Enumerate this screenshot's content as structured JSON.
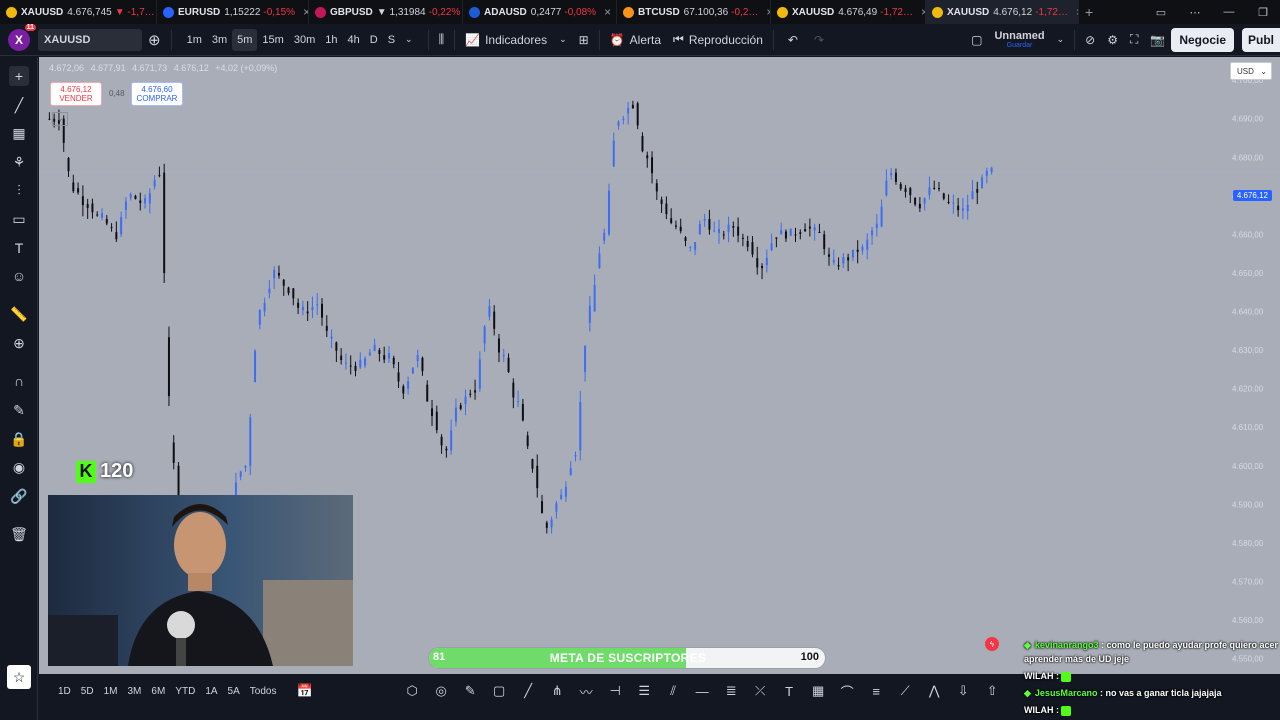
{
  "tabs": [
    {
      "symbol": "XAUUSD",
      "price": "4.676,745",
      "change": "▼ -1,7…",
      "coin_color": "#f0b90b"
    },
    {
      "symbol": "EURUSD",
      "price": "1,15222",
      "change": "-0,15%",
      "coin_color": "#2962ff"
    },
    {
      "symbol": "GBPUSD",
      "price": "▼ 1,31984",
      "change": "-0,22%",
      "coin_color": "#c2185b"
    },
    {
      "symbol": "ADAUSD",
      "price": "0,2477",
      "change": "-0,08%",
      "coin_color": "#1e5bd7"
    },
    {
      "symbol": "BTCUSD",
      "price": "67.100,36",
      "change": "-0,2…",
      "coin_color": "#f7931a"
    },
    {
      "symbol": "XAUUSD",
      "price": "4.676,49",
      "change": "-1,72…",
      "coin_color": "#f0b90b"
    },
    {
      "symbol": "XAUUSD",
      "price": "4.676,12",
      "change": "-1,72…",
      "coin_color": "#f0b90b"
    }
  ],
  "toolbar": {
    "avatar_letter": "X",
    "avatar_badge": "11",
    "symbol": "XAUUSD",
    "timeframes": [
      "1m",
      "3m",
      "5m",
      "15m",
      "30m",
      "1h",
      "4h",
      "D",
      "S"
    ],
    "active_timeframe": "5m",
    "indicators_label": "Indicadores",
    "alert_label": "Alerta",
    "replay_label": "Reproducción",
    "layout_name": "Unnamed",
    "layout_status": "Guardar",
    "trade_label": "Negocie",
    "publish_label": "Publ"
  },
  "chart_info": {
    "ohlc": [
      "4.672,06",
      "4.677,91",
      "4.671,73",
      "4.676,12",
      "+4,02 (+0,09%)"
    ],
    "sell_price": "4.676,12",
    "sell_label": "VENDER",
    "spread": "0,48",
    "buy_price": "4.676,60",
    "buy_label": "COMPRAR",
    "currency": "USD",
    "current_price": "4.676,12"
  },
  "chart_data": {
    "type": "candlestick",
    "symbol": "XAUUSD",
    "interval": "5m",
    "y_ticks": [
      "4.700,00",
      "4.690,00",
      "4.680,00",
      "4.670,00",
      "4.660,00",
      "4.650,00",
      "4.640,00",
      "4.630,00",
      "4.620,00",
      "4.610,00",
      "4.600,00",
      "4.590,00",
      "4.580,00",
      "4.570,00",
      "4.560,00",
      "4.550,00"
    ],
    "ylim": [
      4546,
      4706
    ],
    "last_price": 4676.12,
    "series": [
      {
        "name": "XAUUSD",
        "close": [
          4690,
          4672,
          4668,
          4664,
          4660,
          4670,
          4668,
          4676,
          4600,
          4580,
          4588,
          4582,
          4592,
          4600,
          4640,
          4650,
          4646,
          4640,
          4642,
          4632,
          4626,
          4626,
          4630,
          4628,
          4620,
          4628,
          4614,
          4604,
          4616,
          4620,
          4640,
          4628,
          4616,
          4600,
          4584,
          4592,
          4604,
          4640,
          4660,
          4690,
          4694,
          4680,
          4668,
          4662,
          4656,
          4664,
          4660,
          4662,
          4658,
          4652,
          4660,
          4660,
          4662,
          4660,
          4652,
          4654,
          4656,
          4662,
          4676,
          4672,
          4668,
          4672,
          4668,
          4666,
          4672,
          4676
        ]
      }
    ]
  },
  "bottom": {
    "ranges": [
      "1D",
      "5D",
      "1M",
      "3M",
      "6M",
      "YTD",
      "1A",
      "5A",
      "Todos"
    ]
  },
  "overlay": {
    "kick_letter": "K",
    "kick_count": "120",
    "goal_start": "81",
    "goal_label": "META DE SUSCRIPTORES",
    "goal_end": "100",
    "goal_current": 81,
    "goal_min": 0,
    "goal_max": 100
  },
  "chat": [
    {
      "user": "kevinanrango3",
      "text": ": como le puedo ayudar profe quiero acer aprender más de UD jeje"
    },
    {
      "user": "WILAH",
      "text": ":"
    },
    {
      "user": "JesusMarcano",
      "text": ": no vas a ganar ticla jajajaja"
    },
    {
      "user": "WILAH",
      "text": ":"
    }
  ]
}
